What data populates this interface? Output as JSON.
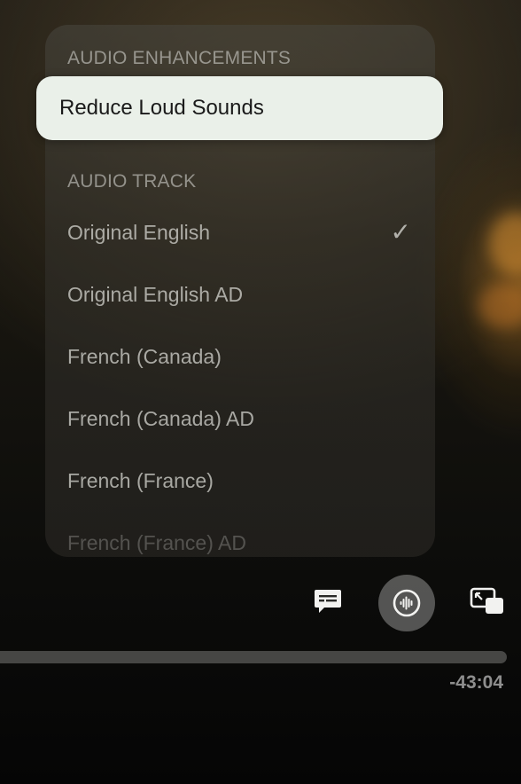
{
  "audio_menu": {
    "enhancements_header": "AUDIO ENHANCEMENTS",
    "enhancements": [
      {
        "label": "Reduce Loud Sounds",
        "highlighted": true
      }
    ],
    "track_header": "AUDIO TRACK",
    "tracks": [
      {
        "label": "Original English",
        "selected": true
      },
      {
        "label": "Original English AD",
        "selected": false
      },
      {
        "label": "French (Canada)",
        "selected": false
      },
      {
        "label": "French (Canada) AD",
        "selected": false
      },
      {
        "label": "French (France)",
        "selected": false
      },
      {
        "label": "French (France) AD",
        "selected": false
      }
    ],
    "selected_mark": "✓"
  },
  "controls": {
    "subtitles_icon": "subtitles-icon",
    "audio_icon": "audio-waveform-icon",
    "pip_icon": "picture-in-picture-icon"
  },
  "playback": {
    "time_remaining": "-43:04"
  },
  "colors": {
    "highlight_bg": "#eaf0e9",
    "menu_text": "#dcdcd7"
  }
}
